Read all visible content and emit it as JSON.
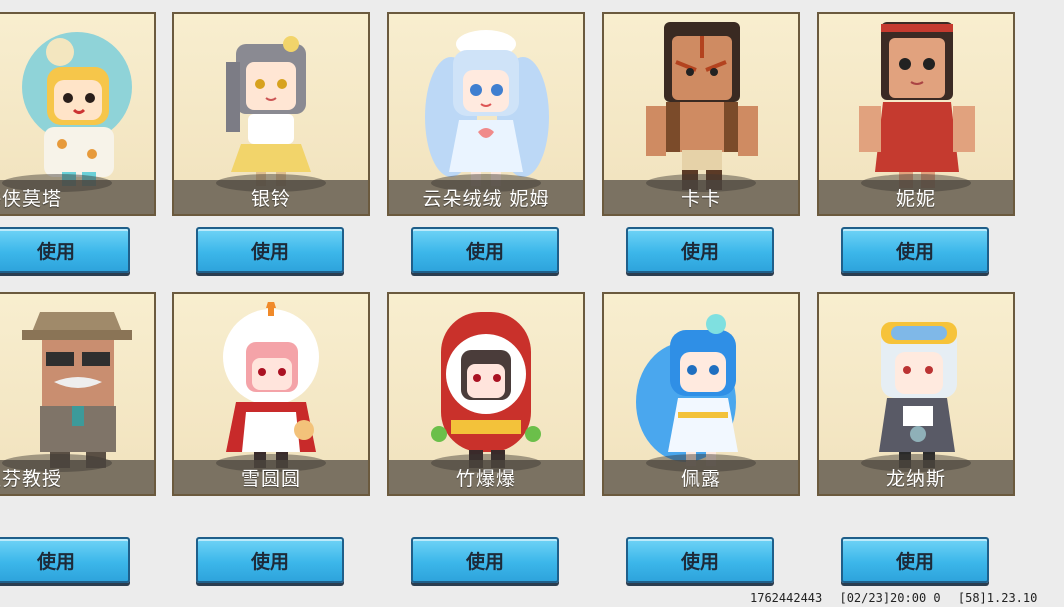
{
  "characters": [
    {
      "name": "小海侠莫塔",
      "button": "使用",
      "colors": {
        "body": "#f7f3e9",
        "hair": "#f6c64a",
        "accent": "#6ad0d8"
      }
    },
    {
      "name": "银铃",
      "button": "使用",
      "colors": {
        "body": "#fff6e0",
        "hair": "#8a8a92",
        "accent": "#f2d46a"
      }
    },
    {
      "name": "云朵绒绒 妮姆",
      "button": "使用",
      "colors": {
        "body": "#eaf4ff",
        "hair": "#bcd8f6",
        "accent": "#f08a8a"
      }
    },
    {
      "name": "卡卡",
      "button": "使用",
      "colors": {
        "body": "#cf8b62",
        "hair": "#3a2a22",
        "accent": "#b3431f"
      }
    },
    {
      "name": "妮妮",
      "button": "使用",
      "colors": {
        "body": "#e1a27e",
        "hair": "#3b2a24",
        "accent": "#c53a2f"
      }
    },
    {
      "name": "史提芬教授",
      "button": "使用",
      "colors": {
        "body": "#7f7468",
        "hair": "#a08a6a",
        "accent": "#2f2f2f"
      }
    },
    {
      "name": "雪圆圆",
      "button": "使用",
      "colors": {
        "body": "#ffffff",
        "hair": "#f4a3a8",
        "accent": "#c82a2a"
      }
    },
    {
      "name": "竹爆爆",
      "button": "使用",
      "colors": {
        "body": "#c9312b",
        "hair": "#4a3c3a",
        "accent": "#f3c23a"
      }
    },
    {
      "name": "佩露",
      "button": "使用",
      "colors": {
        "body": "#f2f8ff",
        "hair": "#2f8fe6",
        "accent": "#7fe0e0"
      }
    },
    {
      "name": "龙纳斯",
      "button": "使用",
      "colors": {
        "body": "#595a66",
        "hair": "#e6eef4",
        "accent": "#f6c33a"
      }
    }
  ],
  "footer": {
    "uid": "1762442443",
    "date": "[02/23]20:00 0",
    "version": "[58]1.23.10"
  }
}
